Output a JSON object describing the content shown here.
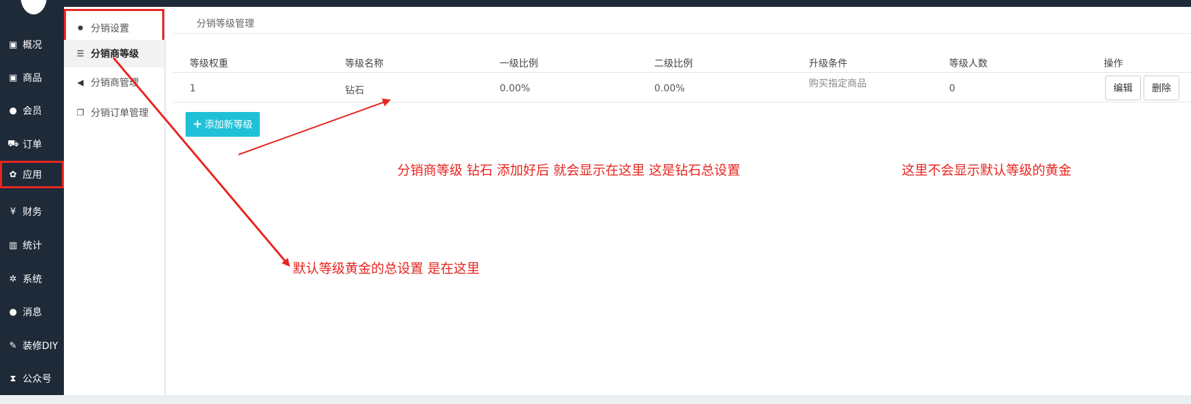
{
  "sidebar": {
    "items": [
      {
        "label": "概况",
        "icon": "archive-icon"
      },
      {
        "label": "商品",
        "icon": "box-icon"
      },
      {
        "label": "会员",
        "icon": "users-icon"
      },
      {
        "label": "订单",
        "icon": "cart-icon"
      },
      {
        "label": "应用",
        "icon": "apps-icon"
      },
      {
        "label": "财务",
        "icon": "yen-icon"
      },
      {
        "label": "统计",
        "icon": "bar-chart-icon"
      },
      {
        "label": "系统",
        "icon": "gears-icon"
      },
      {
        "label": "消息",
        "icon": "chat-icon"
      },
      {
        "label": "装修DIY",
        "icon": "gavel-icon"
      },
      {
        "label": "公众号",
        "icon": "hourglass-icon"
      }
    ],
    "active_index": 4
  },
  "subnav": {
    "items": [
      {
        "label": "分销设置",
        "icon": "gear-icon"
      },
      {
        "label": "分销商等级",
        "icon": "sliders-icon"
      },
      {
        "label": "分销商管理",
        "icon": "share-icon"
      },
      {
        "label": "分销订单管理",
        "icon": "copy-icon"
      }
    ],
    "active_index": 1
  },
  "main": {
    "breadcrumb": "分销等级管理",
    "columns": [
      "等级权重",
      "等级名称",
      "一级比例",
      "二级比例",
      "升级条件",
      "等级人数",
      "操作"
    ],
    "rows": [
      {
        "weight": "1",
        "name": "钻石",
        "level1": "0.00%",
        "level2": "0.00%",
        "condition": "购买指定商品",
        "count": "0",
        "edit": "编辑",
        "delete": "删除"
      }
    ],
    "add_button": "添加新等级"
  },
  "annotations": {
    "note1": "分销商等级 钻石 添加好后 就会显示在这里  这是钻石总设置",
    "note2": "这里不会显示默认等级的黄金",
    "note3": "默认等级黄金的总设置     是在这里"
  },
  "colors": {
    "sidebar": "#1e2a38",
    "accent": "#1fc0d8",
    "annotation": "#e8251f"
  }
}
